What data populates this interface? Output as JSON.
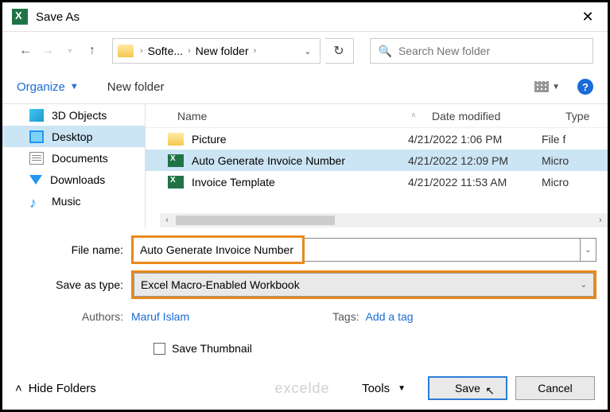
{
  "titlebar": {
    "title": "Save As"
  },
  "breadcrumb": {
    "items": [
      "Softe...",
      "New folder"
    ]
  },
  "search": {
    "placeholder": "Search New folder"
  },
  "toolbar": {
    "organize": "Organize",
    "newfolder": "New folder"
  },
  "sidebar": {
    "items": [
      {
        "label": "3D Objects"
      },
      {
        "label": "Desktop"
      },
      {
        "label": "Documents"
      },
      {
        "label": "Downloads"
      },
      {
        "label": "Music"
      }
    ]
  },
  "filelist": {
    "headers": {
      "name": "Name",
      "date": "Date modified",
      "type": "Type"
    },
    "rows": [
      {
        "name": "Picture",
        "date": "4/21/2022 1:06 PM",
        "type": "File f",
        "icon": "folder"
      },
      {
        "name": "Auto Generate Invoice Number",
        "date": "4/21/2022 12:09 PM",
        "type": "Micro",
        "icon": "xl"
      },
      {
        "name": "Invoice Template",
        "date": "4/21/2022 11:53 AM",
        "type": "Micro",
        "icon": "xl"
      }
    ]
  },
  "form": {
    "filename_label": "File name:",
    "filename_value": "Auto Generate Invoice Number",
    "type_label": "Save as type:",
    "type_value": "Excel Macro-Enabled Workbook",
    "authors_label": "Authors:",
    "authors_value": "Maruf Islam",
    "tags_label": "Tags:",
    "tags_value": "Add a tag",
    "thumb_label": "Save Thumbnail"
  },
  "footer": {
    "hide": "Hide Folders",
    "tools": "Tools",
    "save": "Save",
    "cancel": "Cancel"
  },
  "watermark": "excelde"
}
